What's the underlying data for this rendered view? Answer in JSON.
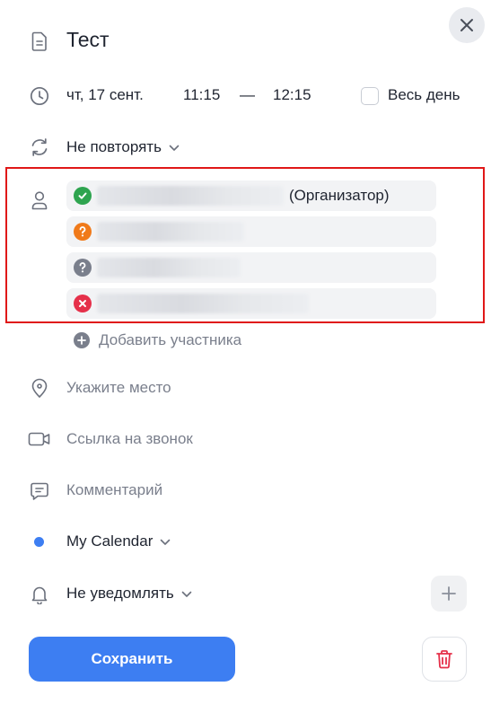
{
  "event": {
    "title": "Тест"
  },
  "datetime": {
    "date": "чт, 17 сент.",
    "start_time": "11:15",
    "separator": "—",
    "end_time": "12:15",
    "all_day_label": "Весь день"
  },
  "repeat": {
    "label": "Не повторять"
  },
  "participants": {
    "organizer_suffix": "(Организатор)",
    "items": [
      {
        "status": "accepted",
        "status_color": "#2ea44f",
        "role": "organizer"
      },
      {
        "status": "pending",
        "status_color": "#f07a1a"
      },
      {
        "status": "unknown",
        "status_color": "#7a7f8c"
      },
      {
        "status": "declined",
        "status_color": "#e5304a"
      }
    ],
    "add_label": "Добавить участника"
  },
  "location": {
    "placeholder": "Укажите место"
  },
  "call_link": {
    "placeholder": "Ссылка на звонок"
  },
  "comment": {
    "placeholder": "Комментарий"
  },
  "calendar": {
    "name": "My Calendar",
    "color": "#3d7ef2"
  },
  "notification": {
    "label": "Не уведомлять"
  },
  "actions": {
    "save_label": "Сохранить"
  },
  "colors": {
    "accent": "#3d7ef2",
    "delete": "#e5304a",
    "highlight": "#e01818"
  }
}
